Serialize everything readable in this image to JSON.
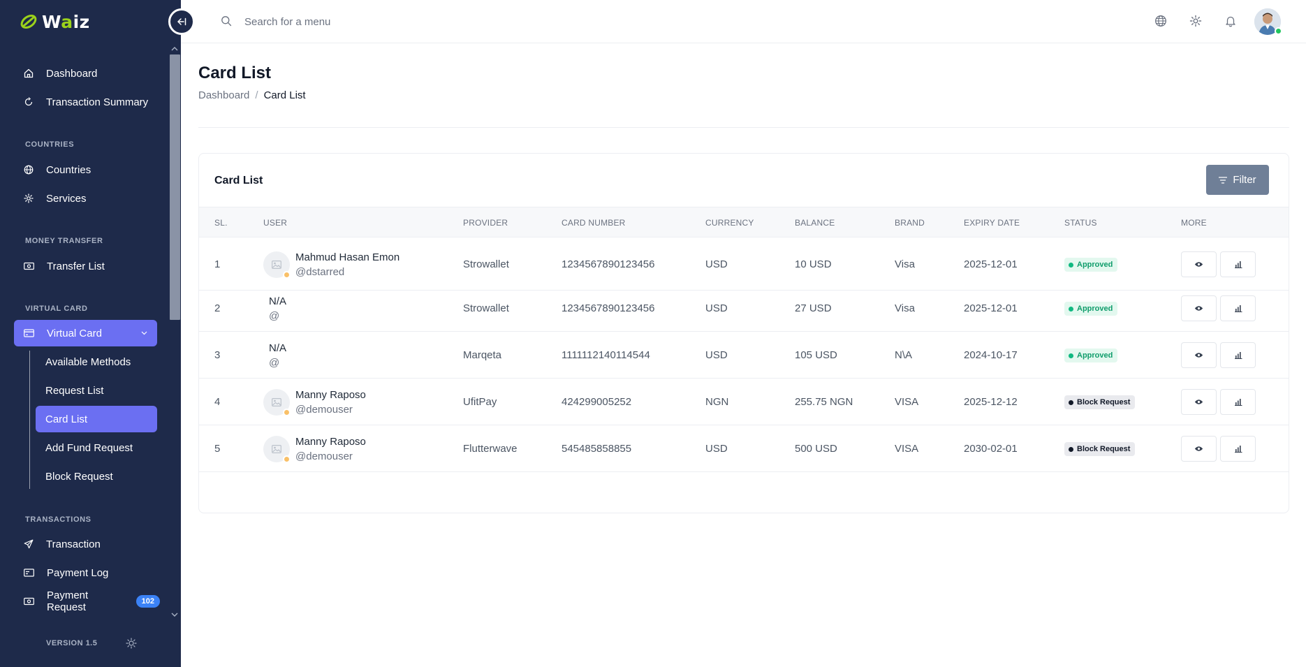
{
  "app": {
    "logo_text_w": "W",
    "logo_text_a": "a",
    "logo_text_rest": "iz",
    "version": "VERSION 1.5"
  },
  "sidebar": {
    "items": [
      {
        "label": "Dashboard",
        "icon": "home-icon"
      },
      {
        "label": "Transaction Summary",
        "icon": "refresh-icon"
      }
    ],
    "sections": {
      "countries": "COUNTRIES",
      "money_transfer": "MONEY TRANSFER",
      "virtual_card": "VIRTUAL CARD",
      "transactions": "TRANSACTIONS"
    },
    "countries_items": [
      {
        "label": "Countries",
        "icon": "globe-icon"
      },
      {
        "label": "Services",
        "icon": "gear-icon"
      }
    ],
    "money_transfer_items": [
      {
        "label": "Transfer List",
        "icon": "money-icon"
      }
    ],
    "virtual_card": {
      "label": "Virtual Card",
      "submenu": [
        "Available Methods",
        "Request List",
        "Card List",
        "Add Fund Request",
        "Block Request"
      ],
      "active_submenu": "Card List"
    },
    "transactions_items": [
      {
        "label": "Transaction",
        "icon": "send-icon"
      },
      {
        "label": "Payment Log",
        "icon": "log-icon"
      },
      {
        "label": "Payment Request",
        "icon": "money-icon",
        "badge": "102"
      }
    ]
  },
  "topbar": {
    "search_placeholder": "Search for a menu"
  },
  "page": {
    "title": "Card List",
    "breadcrumb": {
      "home": "Dashboard",
      "separator": "/",
      "current": "Card List"
    }
  },
  "card": {
    "title": "Card List",
    "filter_label": "Filter",
    "columns": [
      "SL.",
      "USER",
      "PROVIDER",
      "CARD NUMBER",
      "CURRENCY",
      "BALANCE",
      "BRAND",
      "EXPIRY DATE",
      "STATUS",
      "MORE"
    ],
    "rows": [
      {
        "sl": "1",
        "name": "Mahmud Hasan Emon",
        "handle": "@dstarred",
        "has_avatar": true,
        "provider": "Strowallet",
        "card_number": "1234567890123456",
        "currency": "USD",
        "balance": "10 USD",
        "brand": "Visa",
        "expiry": "2025-12-01",
        "status": "Approved",
        "status_type": "approved"
      },
      {
        "sl": "2",
        "name": "N/A",
        "handle": "@",
        "has_avatar": false,
        "provider": "Strowallet",
        "card_number": "1234567890123456",
        "currency": "USD",
        "balance": "27 USD",
        "brand": "Visa",
        "expiry": "2025-12-01",
        "status": "Approved",
        "status_type": "approved"
      },
      {
        "sl": "3",
        "name": "N/A",
        "handle": "@",
        "has_avatar": false,
        "provider": "Marqeta",
        "card_number": "1111112140114544",
        "currency": "USD",
        "balance": "105 USD",
        "brand": "N\\A",
        "expiry": "2024-10-17",
        "status": "Approved",
        "status_type": "approved"
      },
      {
        "sl": "4",
        "name": "Manny Raposo",
        "handle": "@demouser",
        "has_avatar": true,
        "provider": "UfitPay",
        "card_number": "424299005252",
        "currency": "NGN",
        "balance": "255.75 NGN",
        "brand": "VISA",
        "expiry": "2025-12-12",
        "status": "Block Request",
        "status_type": "block"
      },
      {
        "sl": "5",
        "name": "Manny Raposo",
        "handle": "@demouser",
        "has_avatar": true,
        "provider": "Flutterwave",
        "card_number": "545485858855",
        "currency": "USD",
        "balance": "500 USD",
        "brand": "VISA",
        "expiry": "2030-02-01",
        "status": "Block Request",
        "status_type": "block"
      }
    ]
  },
  "colors": {
    "sidebar_bg": "#1e2a4a",
    "accent": "#6b6ff2",
    "filter_bg": "#6f7f97",
    "approved": "#10b981",
    "badge": "#3b82f6"
  }
}
